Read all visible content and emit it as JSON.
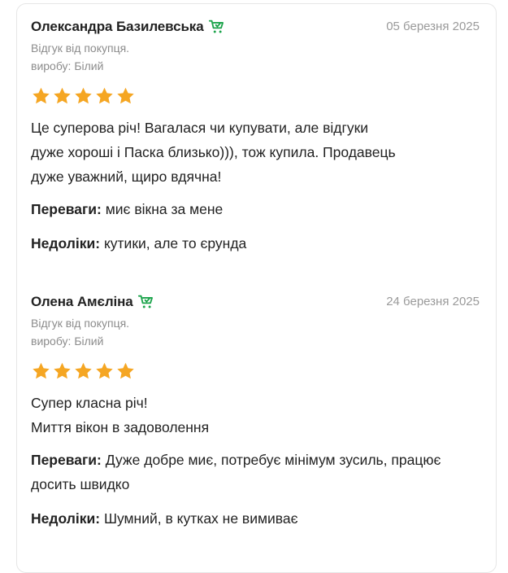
{
  "colors": {
    "star": "#f5a623",
    "cart_icon": "#1aa34a",
    "text": "#222222",
    "muted": "#8c8c8c"
  },
  "reviews": [
    {
      "author": "Олександра Базилевська",
      "badge_icon": "cart-check-icon",
      "date": "05 березня 2025",
      "meta_line1": "Відгук від покупця.",
      "meta_line2": "виробу: Білий",
      "rating": 5,
      "text_lines": [
        "Це суперова річ! Вагалася чи купувати, але відгуки",
        "дуже хороші і Паска близько))), тож купила. Продавець",
        "дуже уважний, щиро вдячна!"
      ],
      "pros_label": "Переваги:",
      "pros": "миє вікна за мене",
      "cons_label": "Недоліки:",
      "cons": "кутики, але то єрунда"
    },
    {
      "author": "Олена Амєліна",
      "badge_icon": "cart-check-icon",
      "date": "24 березня 2025",
      "meta_line1": "Відгук від покупця.",
      "meta_line2": "виробу: Білий",
      "rating": 5,
      "text_lines": [
        "Супер класна річ!",
        "Миття вікон в задоволення"
      ],
      "pros_label": "Переваги:",
      "pros": "Дуже добре миє, потребує мінімум зусиль, працює досить швидко",
      "cons_label": "Недоліки:",
      "cons": "Шумний, в кутках не вимиває"
    }
  ]
}
